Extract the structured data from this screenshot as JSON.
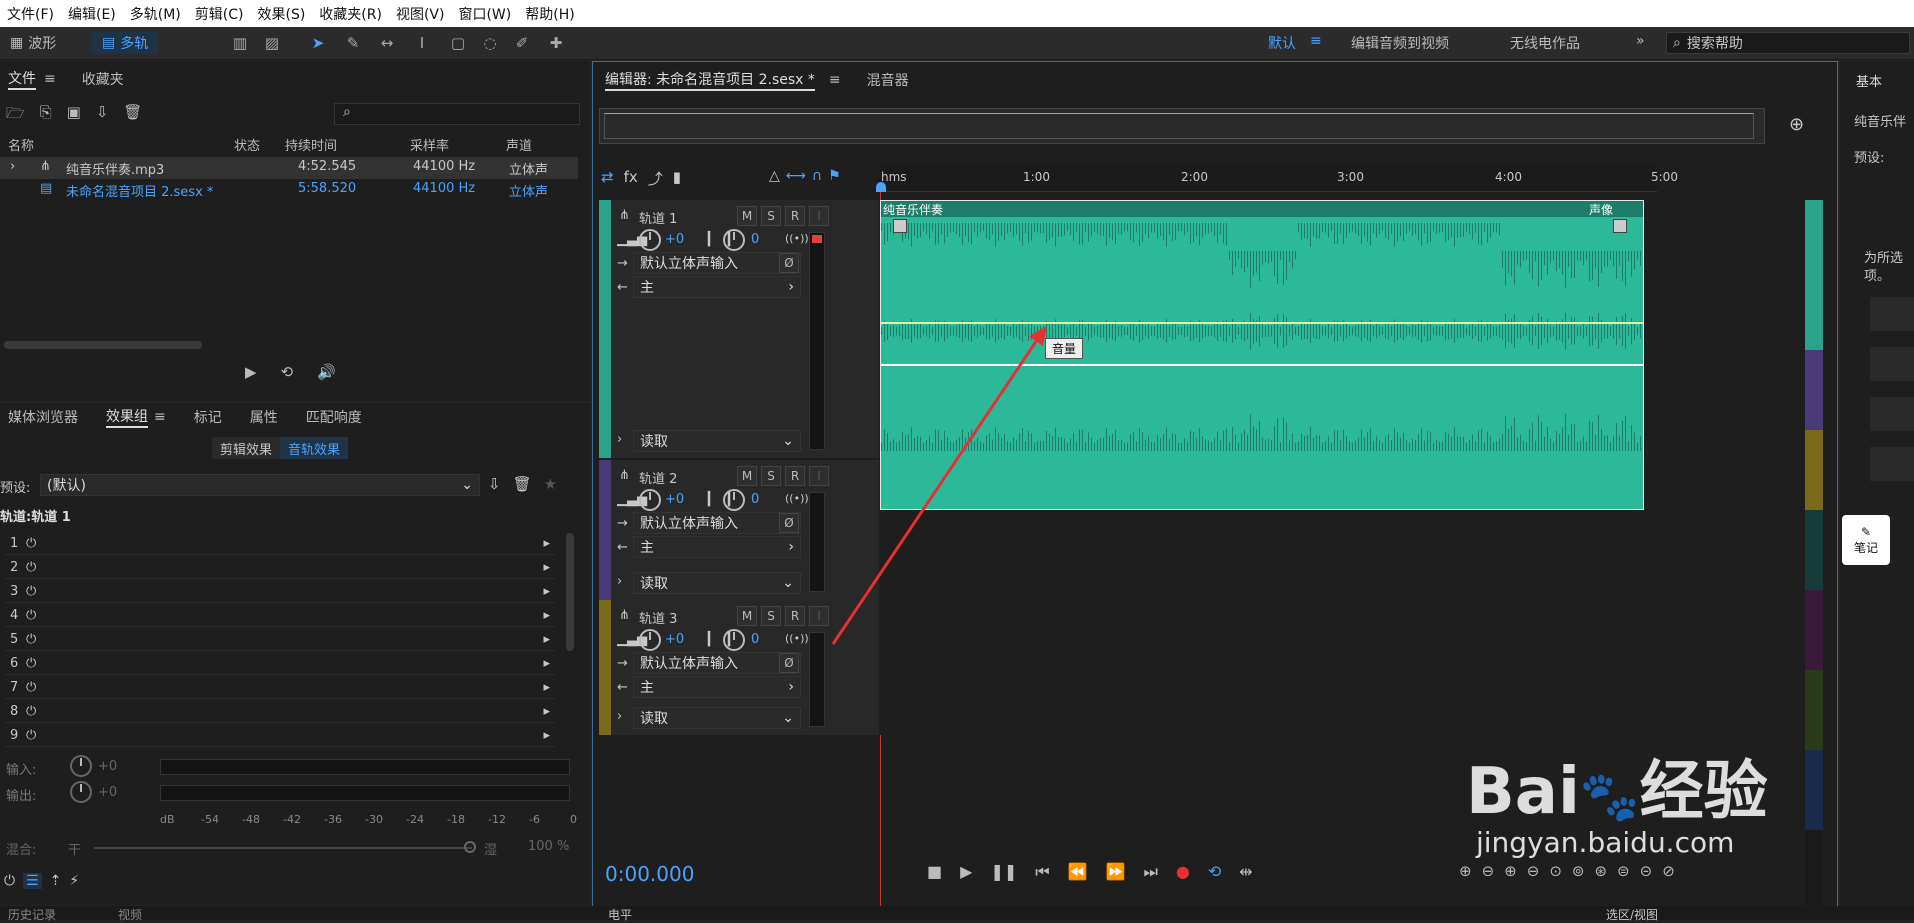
{
  "menu": [
    "文件(F)",
    "编辑(E)",
    "多轨(M)",
    "剪辑(C)",
    "效果(S)",
    "收藏夹(R)",
    "视图(V)",
    "窗口(W)",
    "帮助(H)"
  ],
  "toolbar": {
    "waveform": "波形",
    "multitrack": "多轨",
    "workspaces": [
      "默认",
      "编辑音频到视频",
      "无线电作品"
    ],
    "search": "搜索帮助"
  },
  "files": {
    "tabs": [
      "文件",
      "收藏夹"
    ],
    "headers": [
      "名称",
      "状态",
      "持续时间",
      "采样率",
      "声道"
    ],
    "rows": [
      {
        "name": "纯音乐伴奏.mp3",
        "dur": "4:52.545",
        "rate": "44100 Hz",
        "ch": "立体声"
      },
      {
        "name": "未命名混音项目 2.sesx *",
        "dur": "5:58.520",
        "rate": "44100 Hz",
        "ch": "立体声"
      }
    ]
  },
  "effects": {
    "tabs": [
      "媒体浏览器",
      "效果组",
      "标记",
      "属性",
      "匹配响度"
    ],
    "subtabs": [
      "剪辑效果",
      "音轨效果"
    ],
    "preset_label": "预设:",
    "preset_value": "(默认)",
    "track_label": "轨道:轨道 1",
    "rows": [
      "1",
      "2",
      "3",
      "4",
      "5",
      "6",
      "7",
      "8",
      "9"
    ],
    "input_label": "输入:",
    "output_label": "输出:",
    "gain": "+0",
    "mix_label": "混合:",
    "mix_dry": "干",
    "mix_wet": "湿",
    "mix_pct": "100 %",
    "db_scale": [
      "dB",
      "-54",
      "-48",
      "-42",
      "-36",
      "-30",
      "-24",
      "-18",
      "-12",
      "-6",
      "0"
    ]
  },
  "editor": {
    "tab": "编辑器: 未命名混音项目 2.sesx *",
    "mixer": "混音器",
    "ruler": [
      "hms",
      "1:00",
      "2:00",
      "3:00",
      "4:00",
      "5:00"
    ],
    "time": "0:00.000"
  },
  "tracks": [
    {
      "name": "轨道 1",
      "vol": "+0",
      "pan": "0",
      "input": "默认立体声输入",
      "output": "主",
      "mode": "读取",
      "color": "#2aa38a"
    },
    {
      "name": "轨道 2",
      "vol": "+0",
      "pan": "0",
      "input": "默认立体声输入",
      "output": "主",
      "mode": "读取",
      "color": "#4a3a78"
    },
    {
      "name": "轨道 3",
      "vol": "+0",
      "pan": "0",
      "input": "默认立体声输入",
      "output": "主",
      "mode": "读取",
      "color": "#7a6a1a"
    }
  ],
  "clip": {
    "name": "纯音乐伴奏",
    "pan_label": "声像",
    "tooltip": "音量"
  },
  "right": {
    "tab": "基本",
    "item": "纯音乐伴",
    "preset": "预设:",
    "note1": "为所选",
    "note2": "项。",
    "notes_btn": "笔记"
  },
  "bottom": {
    "levels": "电平",
    "selection": "选区/视图",
    "history": "历史记录",
    "video": "视频"
  },
  "watermark": {
    "text1": "Bai",
    "text2": "经验",
    "url": "jingyan.baidu.com"
  }
}
